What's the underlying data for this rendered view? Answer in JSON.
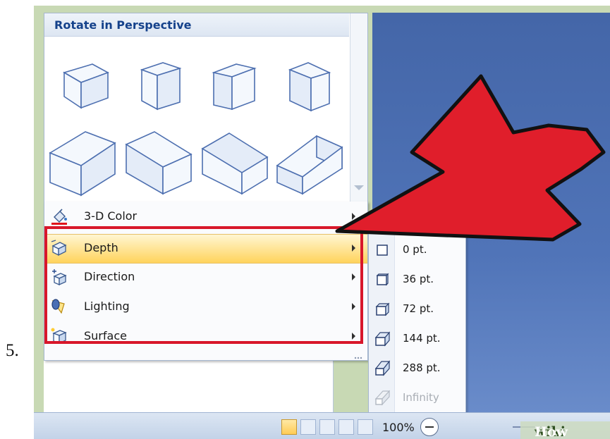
{
  "step_number": "5.",
  "gallery": {
    "title": "Rotate in Perspective",
    "presets": [
      "perspective-preset-1",
      "perspective-preset-2",
      "perspective-preset-3",
      "perspective-preset-4",
      "perspective-preset-5",
      "perspective-preset-6",
      "perspective-preset-7",
      "perspective-preset-8"
    ]
  },
  "menu": {
    "items": [
      {
        "label": "3-D Color",
        "icon": "paint-bucket-icon"
      },
      {
        "label": "Depth",
        "icon": "depth-cube-icon"
      },
      {
        "label": "Direction",
        "icon": "direction-cube-icon"
      },
      {
        "label": "Lighting",
        "icon": "light-bulb-icon"
      },
      {
        "label": "Surface",
        "icon": "surface-cube-icon"
      }
    ]
  },
  "depth_submenu": {
    "items": [
      {
        "label": "0 pt."
      },
      {
        "label": "36 pt."
      },
      {
        "label": "72 pt."
      },
      {
        "label": "144 pt."
      },
      {
        "label": "288 pt."
      },
      {
        "label": "Infinity",
        "disabled": true
      }
    ]
  },
  "status_bar": {
    "zoom_label": "100%"
  },
  "watermark": {
    "part1": "wiki",
    "part2": "How"
  },
  "colors": {
    "annotation_red": "#d8172a",
    "highlight": "#ffd35c",
    "doc_blue": "#4466a8"
  }
}
